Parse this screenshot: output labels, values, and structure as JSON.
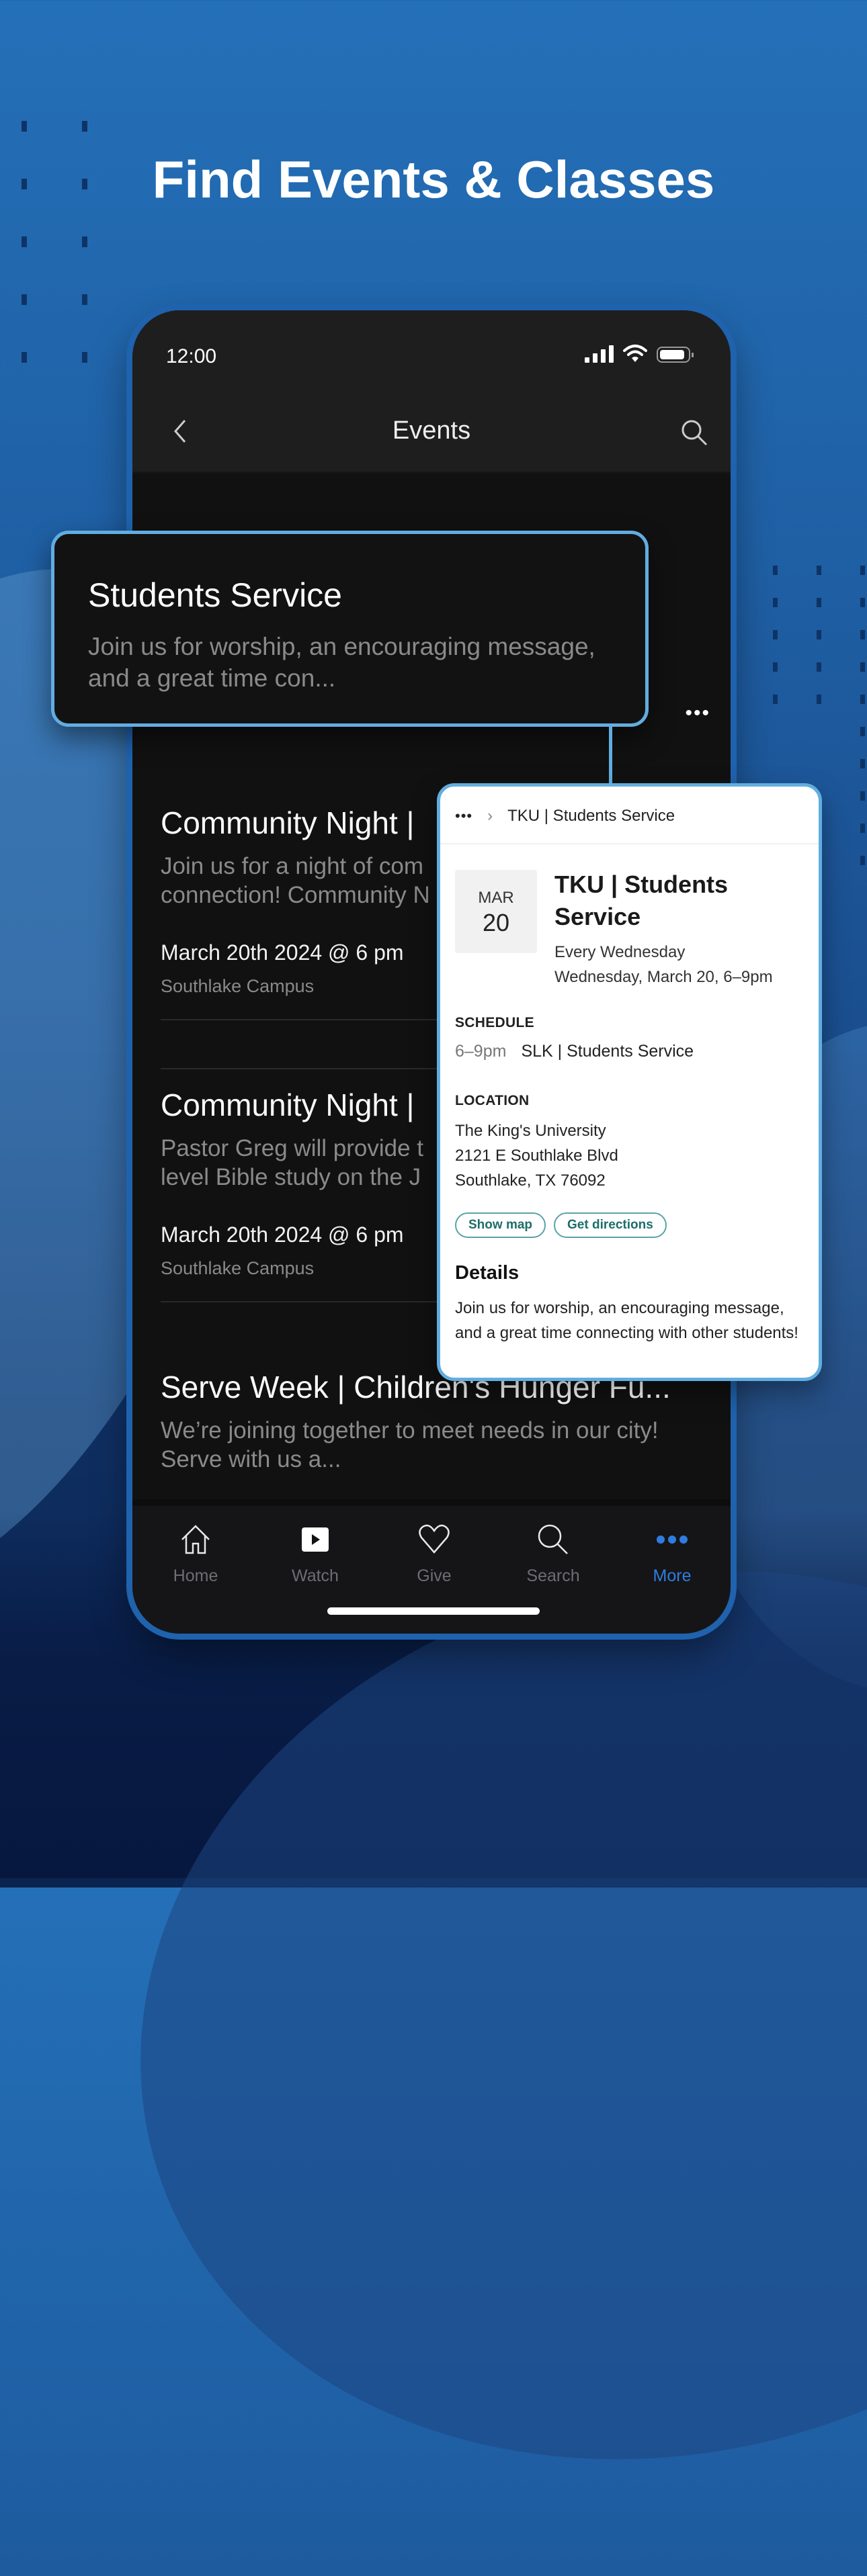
{
  "headline": "Find Events & Classes",
  "status_bar": {
    "time": "12:00"
  },
  "nav": {
    "title": "Events",
    "back_icon": "chevron-left-icon",
    "search_icon": "search-icon"
  },
  "events": [
    {
      "title": "Students Service",
      "description": "Join us for worship, an encouraging message, and a great time con..."
    },
    {
      "title": "Community Night | ",
      "description": "Join us for a night of com… connection! Community N…",
      "desc_line1": "Join us for a night of com",
      "desc_line2": "connection! Community N",
      "datetime": "March 20th 2024 @ 6 pm",
      "location": "Southlake Campus"
    },
    {
      "title": "Community Night | ",
      "desc_line1": "Pastor Greg will provide t",
      "desc_line2": "level Bible study on the J",
      "datetime": "March 20th 2024 @ 6 pm",
      "location": "Southlake Campus"
    },
    {
      "title": "Serve Week | Children's Hunger Fu...",
      "desc_line1": "We’re joining together to meet needs in our city!",
      "desc_line2": "Serve with us a..."
    }
  ],
  "list_more_icon": "•••",
  "callout_card": {
    "title": "Students Service",
    "description": "Join us for worship, an encouraging message, and a great time con..."
  },
  "detail_panel": {
    "breadcrumb_more": "•••",
    "breadcrumb_sep": "›",
    "breadcrumb_current": "TKU | Students Service",
    "date_month": "MAR",
    "date_day": "20",
    "title": "TKU | Students Service",
    "recurrence": "Every Wednesday",
    "date_full": "Wednesday, March 20, 6–9pm",
    "schedule_label": "SCHEDULE",
    "schedule_time": "6–9pm",
    "schedule_name": "SLK | Students Service",
    "location_label": "LOCATION",
    "address_line1": "The King's University",
    "address_line2": "2121 E Southlake Blvd",
    "address_line3": "Southlake, TX 76092",
    "show_map": "Show map",
    "get_directions": "Get directions",
    "details_label": "Details",
    "details_body": "Join us for worship, an encouraging message, and a great time connecting with other students!"
  },
  "tabbar": {
    "items": [
      {
        "label": "Home",
        "icon": "home-icon",
        "active": false
      },
      {
        "label": "Watch",
        "icon": "play-icon",
        "active": false
      },
      {
        "label": "Give",
        "icon": "heart-icon",
        "active": false
      },
      {
        "label": "Search",
        "icon": "search-icon",
        "active": false
      },
      {
        "label": "More",
        "icon": "more-icon",
        "active": true
      }
    ]
  },
  "colors": {
    "accent_blue": "#2f7ce0",
    "callout_border": "#62addf",
    "pill_text": "#1d6e68"
  }
}
